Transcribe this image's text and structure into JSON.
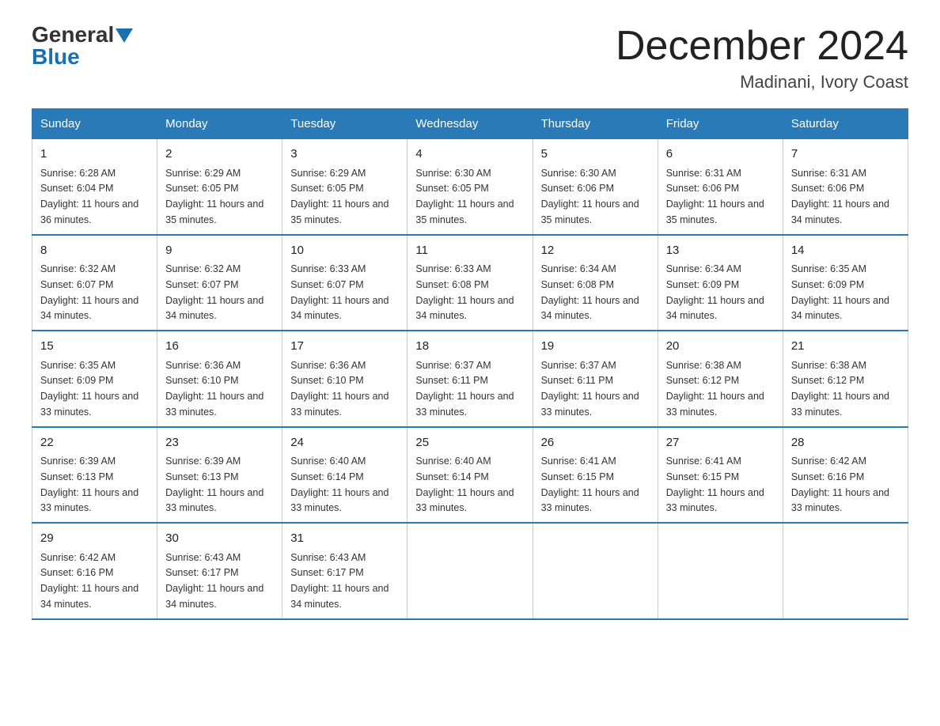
{
  "logo": {
    "general": "General",
    "blue": "Blue"
  },
  "title": "December 2024",
  "subtitle": "Madinani, Ivory Coast",
  "days_of_week": [
    "Sunday",
    "Monday",
    "Tuesday",
    "Wednesday",
    "Thursday",
    "Friday",
    "Saturday"
  ],
  "weeks": [
    [
      {
        "day": "1",
        "sunrise": "6:28 AM",
        "sunset": "6:04 PM",
        "daylight": "11 hours and 36 minutes."
      },
      {
        "day": "2",
        "sunrise": "6:29 AM",
        "sunset": "6:05 PM",
        "daylight": "11 hours and 35 minutes."
      },
      {
        "day": "3",
        "sunrise": "6:29 AM",
        "sunset": "6:05 PM",
        "daylight": "11 hours and 35 minutes."
      },
      {
        "day": "4",
        "sunrise": "6:30 AM",
        "sunset": "6:05 PM",
        "daylight": "11 hours and 35 minutes."
      },
      {
        "day": "5",
        "sunrise": "6:30 AM",
        "sunset": "6:06 PM",
        "daylight": "11 hours and 35 minutes."
      },
      {
        "day": "6",
        "sunrise": "6:31 AM",
        "sunset": "6:06 PM",
        "daylight": "11 hours and 35 minutes."
      },
      {
        "day": "7",
        "sunrise": "6:31 AM",
        "sunset": "6:06 PM",
        "daylight": "11 hours and 34 minutes."
      }
    ],
    [
      {
        "day": "8",
        "sunrise": "6:32 AM",
        "sunset": "6:07 PM",
        "daylight": "11 hours and 34 minutes."
      },
      {
        "day": "9",
        "sunrise": "6:32 AM",
        "sunset": "6:07 PM",
        "daylight": "11 hours and 34 minutes."
      },
      {
        "day": "10",
        "sunrise": "6:33 AM",
        "sunset": "6:07 PM",
        "daylight": "11 hours and 34 minutes."
      },
      {
        "day": "11",
        "sunrise": "6:33 AM",
        "sunset": "6:08 PM",
        "daylight": "11 hours and 34 minutes."
      },
      {
        "day": "12",
        "sunrise": "6:34 AM",
        "sunset": "6:08 PM",
        "daylight": "11 hours and 34 minutes."
      },
      {
        "day": "13",
        "sunrise": "6:34 AM",
        "sunset": "6:09 PM",
        "daylight": "11 hours and 34 minutes."
      },
      {
        "day": "14",
        "sunrise": "6:35 AM",
        "sunset": "6:09 PM",
        "daylight": "11 hours and 34 minutes."
      }
    ],
    [
      {
        "day": "15",
        "sunrise": "6:35 AM",
        "sunset": "6:09 PM",
        "daylight": "11 hours and 33 minutes."
      },
      {
        "day": "16",
        "sunrise": "6:36 AM",
        "sunset": "6:10 PM",
        "daylight": "11 hours and 33 minutes."
      },
      {
        "day": "17",
        "sunrise": "6:36 AM",
        "sunset": "6:10 PM",
        "daylight": "11 hours and 33 minutes."
      },
      {
        "day": "18",
        "sunrise": "6:37 AM",
        "sunset": "6:11 PM",
        "daylight": "11 hours and 33 minutes."
      },
      {
        "day": "19",
        "sunrise": "6:37 AM",
        "sunset": "6:11 PM",
        "daylight": "11 hours and 33 minutes."
      },
      {
        "day": "20",
        "sunrise": "6:38 AM",
        "sunset": "6:12 PM",
        "daylight": "11 hours and 33 minutes."
      },
      {
        "day": "21",
        "sunrise": "6:38 AM",
        "sunset": "6:12 PM",
        "daylight": "11 hours and 33 minutes."
      }
    ],
    [
      {
        "day": "22",
        "sunrise": "6:39 AM",
        "sunset": "6:13 PM",
        "daylight": "11 hours and 33 minutes."
      },
      {
        "day": "23",
        "sunrise": "6:39 AM",
        "sunset": "6:13 PM",
        "daylight": "11 hours and 33 minutes."
      },
      {
        "day": "24",
        "sunrise": "6:40 AM",
        "sunset": "6:14 PM",
        "daylight": "11 hours and 33 minutes."
      },
      {
        "day": "25",
        "sunrise": "6:40 AM",
        "sunset": "6:14 PM",
        "daylight": "11 hours and 33 minutes."
      },
      {
        "day": "26",
        "sunrise": "6:41 AM",
        "sunset": "6:15 PM",
        "daylight": "11 hours and 33 minutes."
      },
      {
        "day": "27",
        "sunrise": "6:41 AM",
        "sunset": "6:15 PM",
        "daylight": "11 hours and 33 minutes."
      },
      {
        "day": "28",
        "sunrise": "6:42 AM",
        "sunset": "6:16 PM",
        "daylight": "11 hours and 33 minutes."
      }
    ],
    [
      {
        "day": "29",
        "sunrise": "6:42 AM",
        "sunset": "6:16 PM",
        "daylight": "11 hours and 34 minutes."
      },
      {
        "day": "30",
        "sunrise": "6:43 AM",
        "sunset": "6:17 PM",
        "daylight": "11 hours and 34 minutes."
      },
      {
        "day": "31",
        "sunrise": "6:43 AM",
        "sunset": "6:17 PM",
        "daylight": "11 hours and 34 minutes."
      },
      null,
      null,
      null,
      null
    ]
  ]
}
